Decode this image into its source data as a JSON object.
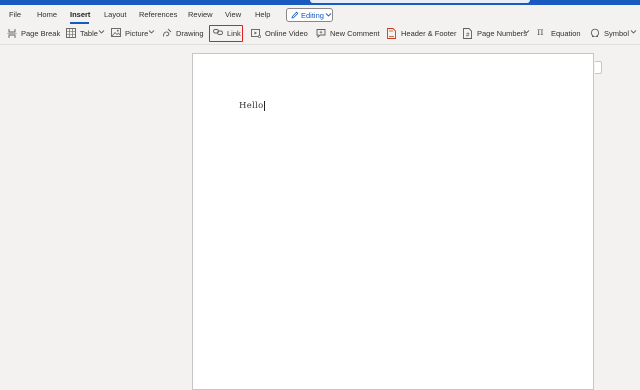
{
  "menu": {
    "items": [
      {
        "label": "File"
      },
      {
        "label": "Home"
      },
      {
        "label": "Insert"
      },
      {
        "label": "Layout"
      },
      {
        "label": "References"
      },
      {
        "label": "Review"
      },
      {
        "label": "View"
      },
      {
        "label": "Help"
      }
    ],
    "active": "Insert",
    "mode_button": {
      "label": "Editing",
      "icon": "pencil-icon"
    }
  },
  "ribbon": {
    "page_break": {
      "label": "Page Break",
      "icon": "page-break-icon"
    },
    "table": {
      "label": "Table",
      "icon": "table-icon",
      "has_dropdown": true
    },
    "picture": {
      "label": "Picture",
      "icon": "picture-icon",
      "has_dropdown": true
    },
    "drawing": {
      "label": "Drawing",
      "icon": "drawing-icon"
    },
    "link": {
      "label": "Link",
      "icon": "link-icon",
      "highlighted": true
    },
    "online_video": {
      "label": "Online Video",
      "icon": "online-video-icon"
    },
    "new_comment": {
      "label": "New Comment",
      "icon": "comment-icon"
    },
    "header_footer": {
      "label": "Header & Footer",
      "icon": "header-footer-icon"
    },
    "page_numbers": {
      "label": "Page Numbers",
      "icon": "page-numbers-icon",
      "has_dropdown": true
    },
    "equation": {
      "label": "Equation",
      "icon": "equation-icon",
      "symbol": "π"
    },
    "symbol": {
      "label": "Symbol",
      "icon": "omega-icon",
      "has_dropdown": true
    }
  },
  "document": {
    "text": "Hello"
  },
  "colors": {
    "accent": "#185abd",
    "highlight": "#e02020",
    "background": "#f3f2f1",
    "page": "#ffffff"
  }
}
